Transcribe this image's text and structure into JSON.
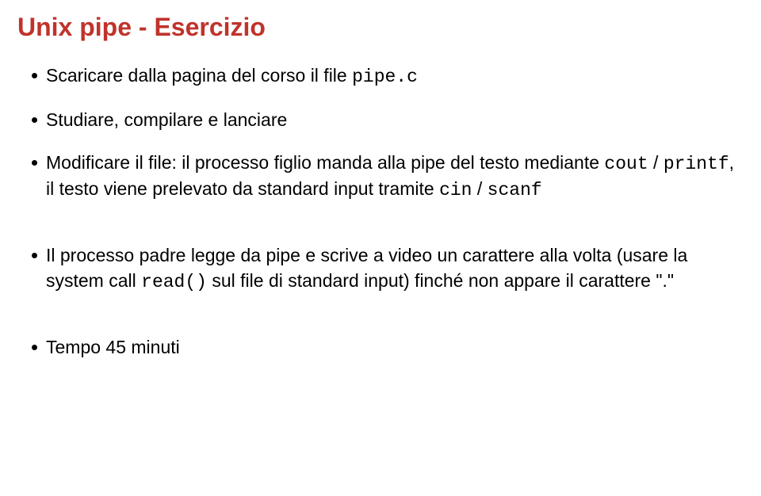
{
  "title": "Unix pipe - Esercizio",
  "items": {
    "b1_part1": "Scaricare dalla pagina del corso il file ",
    "b1_code": "pipe.c",
    "b2": "Studiare, compilare e lanciare",
    "b3_part1": "Modificare il file: il processo figlio manda alla pipe del testo mediante ",
    "b3_code1": "cout",
    "b3_text_slash": " / ",
    "b3_code2": "printf",
    "b3_part2": ", il testo viene prelevato da standard input tramite ",
    "b3_code3": "cin",
    "b3_text_slash2": " / ",
    "b3_code4": "scanf",
    "b4_part1": "Il processo padre legge da pipe e scrive a video un carattere alla volta (usare la system call ",
    "b4_code1": "read()",
    "b4_part2": " sul file di standard input) finché non appare il carattere \".\"",
    "b5": "Tempo 45 minuti"
  }
}
